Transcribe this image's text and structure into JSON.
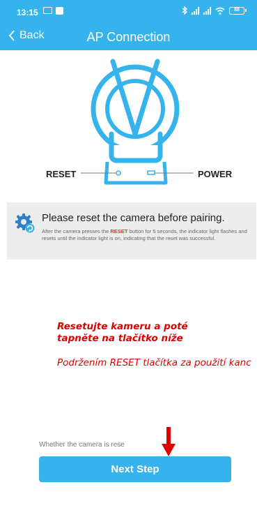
{
  "status_bar": {
    "time": "13:15",
    "battery": "88"
  },
  "nav": {
    "back_label": "Back",
    "title": "AP Connection"
  },
  "illustration": {
    "reset_label": "RESET",
    "power_label": "POWER"
  },
  "info": {
    "title": "Please reset the camera before pairing.",
    "desc_before": "After the camera presses the ",
    "desc_highlight": "RESET",
    "desc_after": " button for 5 seconds, the indicator light flashes and resets until the indicator light is on, indicating that the reset was successful."
  },
  "overlay_text": {
    "line1": "Resetujte kameru a poté",
    "line2": "tapněte na tlačítko níže",
    "line3": "Podržením RESET tlačítka za použití kanc"
  },
  "footer": {
    "checkbox_label": "Whether the camera is rese",
    "next_button": "Next Step"
  },
  "colors": {
    "accent": "#35b3ec",
    "overlay_red": "#e00000"
  }
}
